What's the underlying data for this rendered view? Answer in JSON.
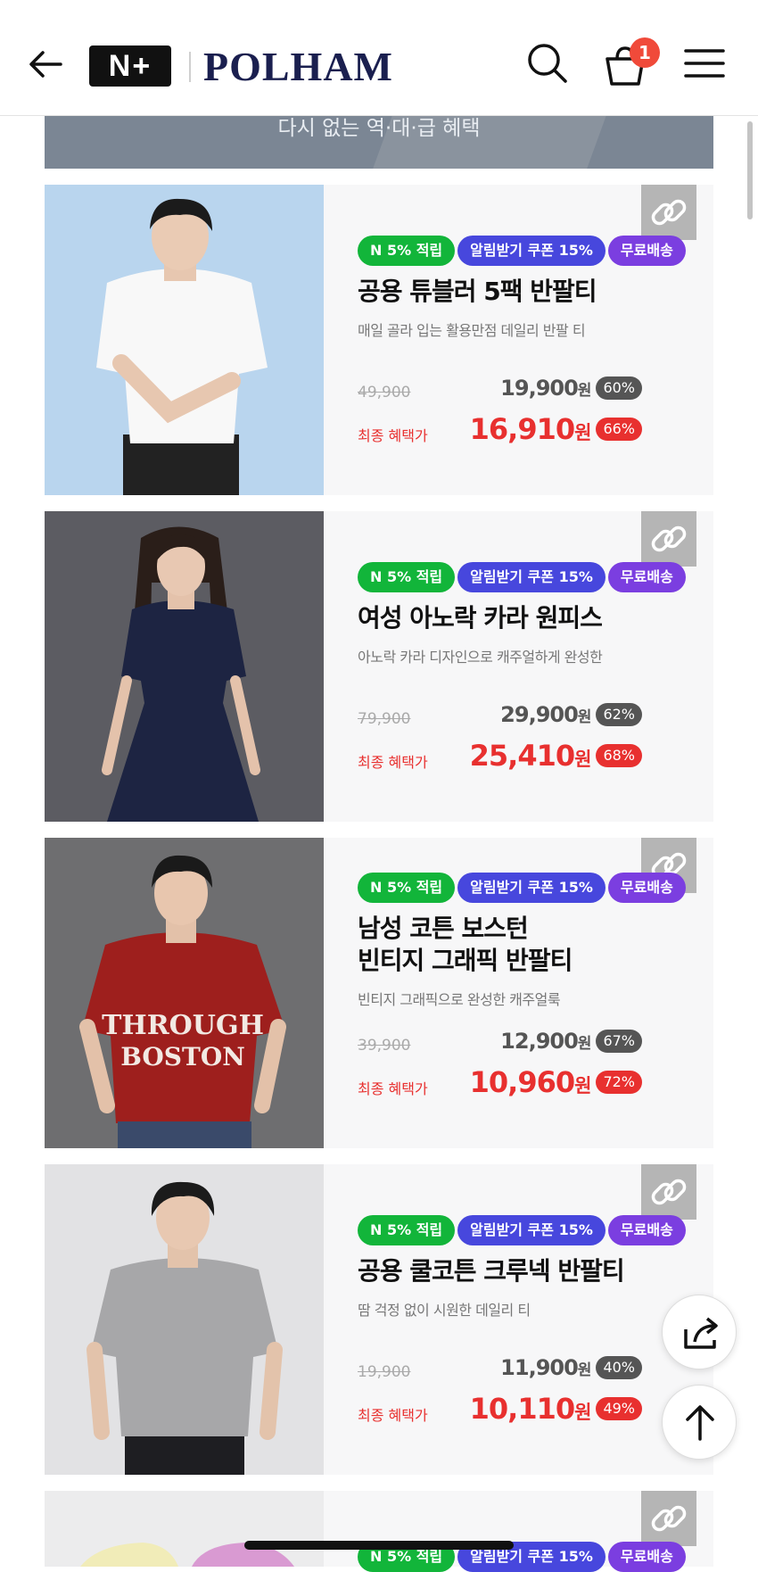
{
  "header": {
    "brand_badge": "N+",
    "brand": "POLHAM",
    "cart_count": "1"
  },
  "banner": {
    "text": "다시 없는 역·대·급 혜택"
  },
  "products": [
    {
      "tags": [
        "N 5% 적립",
        "알림받기 쿠폰 15%",
        "무료배송"
      ],
      "title_lines": [
        "공용 튜블러 5팩 반팔티"
      ],
      "desc": "매일 골라 입는 활용만점 데일리 반팔 티",
      "original_price": "49,900",
      "price": "19,900",
      "won": "원",
      "discount": "60%",
      "final_label": "최종 혜택가",
      "final_price": "16,910",
      "final_discount": "66%"
    },
    {
      "tags": [
        "N 5% 적립",
        "알림받기 쿠폰 15%",
        "무료배송"
      ],
      "title_lines": [
        "여성 아노락 카라 원피스"
      ],
      "desc": "아노락 카라 디자인으로 캐주얼하게 완성한",
      "original_price": "79,900",
      "price": "29,900",
      "won": "원",
      "discount": "62%",
      "final_label": "최종 혜택가",
      "final_price": "25,410",
      "final_discount": "68%"
    },
    {
      "tags": [
        "N 5% 적립",
        "알림받기 쿠폰 15%",
        "무료배송"
      ],
      "title_lines": [
        "남성 코튼 보스턴",
        "빈티지 그래픽 반팔티"
      ],
      "desc": "빈티지 그래픽으로 완성한 캐주얼룩",
      "original_price": "39,900",
      "price": "12,900",
      "won": "원",
      "discount": "67%",
      "final_label": "최종 혜택가",
      "final_price": "10,960",
      "final_discount": "72%"
    },
    {
      "tags": [
        "N 5% 적립",
        "알림받기 쿠폰 15%",
        "무료배송"
      ],
      "title_lines": [
        "공용 쿨코튼 크루넥 반팔티"
      ],
      "desc": "땀 걱정 없이 시원한 데일리 티",
      "original_price": "19,900",
      "price": "11,900",
      "won": "원",
      "discount": "40%",
      "final_label": "최종 혜택가",
      "final_price": "10,110",
      "final_discount": "49%"
    },
    {
      "tags": [
        "N 5% 적립",
        "알림받기 쿠폰 15%",
        "무료배송"
      ]
    }
  ],
  "colors": {
    "accent_red": "#e8302f",
    "tag_green": "#12b53a",
    "tag_blue": "#4747dd",
    "tag_purple": "#7b3ee0",
    "brand_navy": "#1a1f4f"
  }
}
